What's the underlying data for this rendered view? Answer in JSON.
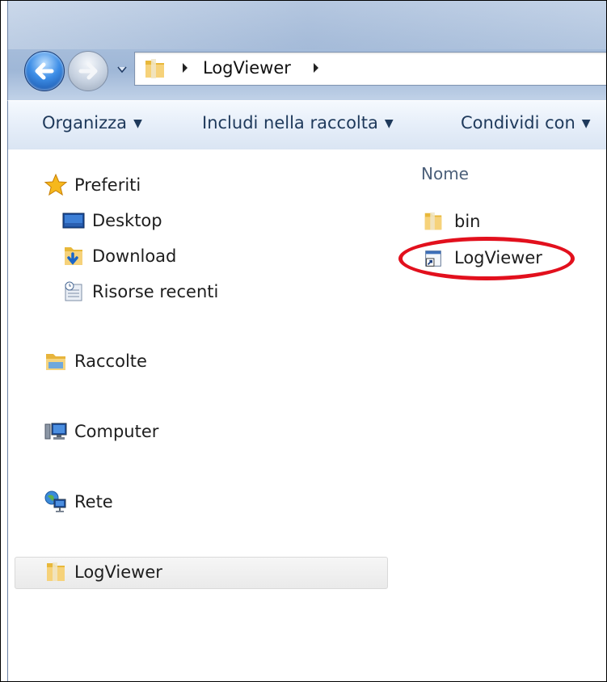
{
  "address_bar": {
    "path": "LogViewer"
  },
  "toolbar": {
    "organize": "Organizza",
    "include_library": "Includi nella raccolta",
    "share_with": "Condividi con"
  },
  "nav_pane": {
    "favorites": "Preferiti",
    "desktop": "Desktop",
    "downloads": "Download",
    "recent": "Risorse recenti",
    "libraries": "Raccolte",
    "computer": "Computer",
    "network": "Rete",
    "selected_folder": "LogViewer"
  },
  "content": {
    "column_name": "Nome",
    "items": [
      {
        "name": "bin",
        "icon": "folder-icon"
      },
      {
        "name": "LogViewer",
        "icon": "shortcut-icon"
      }
    ]
  },
  "colors": {
    "highlight": "#e2101d",
    "toolbar_text": "#1e395b"
  }
}
